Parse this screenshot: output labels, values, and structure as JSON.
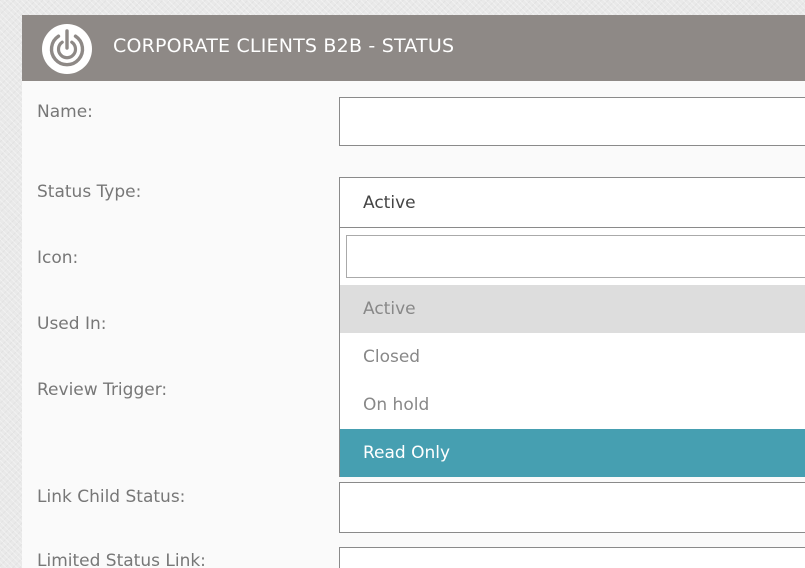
{
  "header": {
    "title": "CORPORATE CLIENTS B2B - STATUS"
  },
  "form": {
    "name_label": "Name:",
    "name_value": "",
    "status_type_label": "Status Type:",
    "status_type_value": "Active",
    "icon_label": "Icon:",
    "used_in_label": "Used In:",
    "review_trigger_label": "Review Trigger:",
    "link_child_status_label": "Link Child Status:",
    "link_child_status_value": "",
    "limited_status_link_label": "Limited Status Link:",
    "limited_status_link_value": ""
  },
  "dropdown": {
    "search_value": "",
    "options": [
      {
        "label": "Active",
        "state": "hover"
      },
      {
        "label": "Closed",
        "state": "normal"
      },
      {
        "label": "On hold",
        "state": "normal"
      },
      {
        "label": "Read Only",
        "state": "selected"
      }
    ]
  },
  "colors": {
    "header_bg": "#8e8986",
    "selected_option_bg": "#469fb1",
    "hover_option_bg": "#dddddd",
    "label_text": "#777777"
  }
}
